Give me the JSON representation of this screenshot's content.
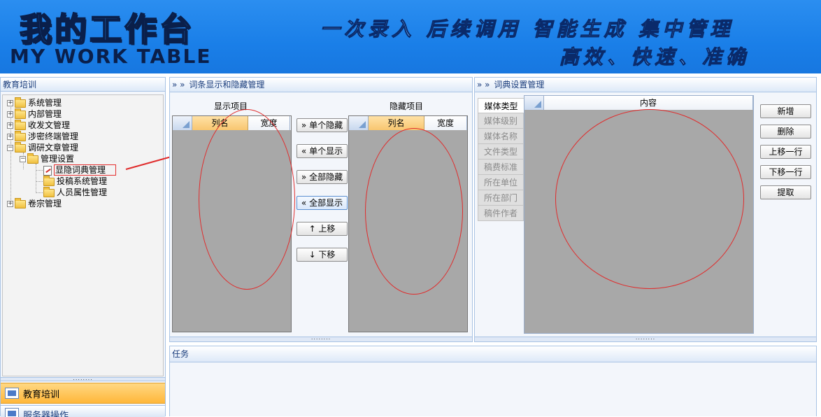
{
  "banner": {
    "logo_cn": "我的工作台",
    "logo_en": "MY WORK TABLE",
    "slogan_line1": "一次录入 后续调用 智能生成 集中管理",
    "slogan_line2": "高效、快速、准确"
  },
  "left": {
    "title": "教育培训",
    "tree": [
      {
        "label": "系统管理"
      },
      {
        "label": "内部管理"
      },
      {
        "label": "收发文管理"
      },
      {
        "label": "涉密终端管理"
      },
      {
        "label": "调研文章管理"
      },
      {
        "label": "管理设置"
      },
      {
        "label": "显隐词典管理"
      },
      {
        "label": "投稿系统管理"
      },
      {
        "label": "人员属性管理"
      },
      {
        "label": "卷宗管理"
      }
    ],
    "accordion": [
      {
        "label": "教育培训"
      },
      {
        "label": "服务器操作"
      }
    ]
  },
  "middle": {
    "title": "词条显示和隐藏管理",
    "title_arrows": "» »",
    "shown_caption": "显示项目",
    "hidden_caption": "隐藏项目",
    "col_name": "列名",
    "col_width": "宽度",
    "buttons": [
      "» 单个隐藏",
      "« 单个显示",
      "» 全部隐藏",
      "« 全部显示",
      "↑ 上移",
      "↓ 下移"
    ]
  },
  "right": {
    "title": "词典设置管理",
    "title_arrows": "» »",
    "tabs": [
      "媒体类型",
      "媒体级别",
      "媒体名称",
      "文件类型",
      "稿费标准",
      "所在单位",
      "所在部门",
      "稿件作者"
    ],
    "col_content": "内容",
    "buttons": [
      "新增",
      "删除",
      "上移一行",
      "下移一行",
      "提取"
    ]
  },
  "bottom": {
    "title": "任务"
  },
  "splitter_dots": "........",
  "colors": {
    "banner_blue": "#1a7fe8",
    "accent_orange": "#ffb73a",
    "annotation_red": "#e02c2c"
  }
}
